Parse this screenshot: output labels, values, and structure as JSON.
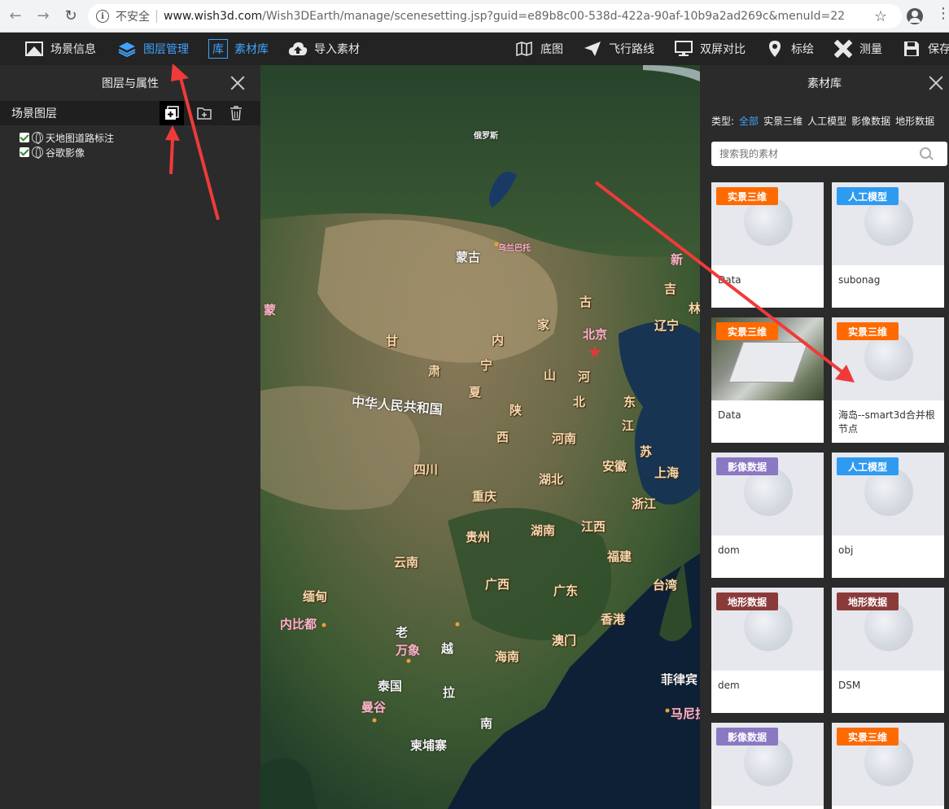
{
  "browser": {
    "insecure_label": "不安全",
    "url_host": "www.wish3d.com",
    "url_path": "/Wish3DEarth/manage/scenesetting.jsp?guid=e89b8c00-538d-422a-90af-10b9a2ad269c&menuId=22"
  },
  "toolbar": {
    "scene_info": "场景信息",
    "layer_manage": "图层管理",
    "library_icon": "库",
    "library": "素材库",
    "import": "导入素材",
    "basemap": "底图",
    "flight": "飞行路线",
    "dual": "双屏对比",
    "mark": "标绘",
    "measure": "测量",
    "save": "保存"
  },
  "left_panel": {
    "title": "图层与属性",
    "section": "场景图层",
    "layers": [
      "天地图道路标注",
      "谷歌影像"
    ]
  },
  "map": {
    "labels": [
      "俄罗斯",
      "蒙古",
      "乌兰巴托",
      "中华人民共和国",
      "北京",
      "内",
      "家",
      "古",
      "辽宁",
      "吉",
      "林",
      "宁",
      "夏",
      "甘",
      "肃",
      "陕",
      "西",
      "山",
      "河",
      "北",
      "东",
      "江",
      "苏",
      "安徽",
      "上海",
      "河南",
      "湖北",
      "浙江",
      "四川",
      "重庆",
      "贵州",
      "湖南",
      "江西",
      "福建",
      "台湾",
      "云南",
      "广西",
      "广东",
      "香港",
      "澳门",
      "海南",
      "缅甸",
      "内比都",
      "老",
      "万象",
      "越",
      "泰国",
      "曼谷",
      "南",
      "柬埔寨",
      "菲律宾",
      "马尼拉",
      "拉",
      "蒙",
      "新"
    ]
  },
  "right_panel": {
    "title": "素材库",
    "types_label": "类型:",
    "types": [
      "全部",
      "实景三维",
      "人工模型",
      "影像数据",
      "地形数据"
    ],
    "search_placeholder": "搜索我的素材",
    "cards": [
      {
        "badge": "实景三维",
        "name": "Data"
      },
      {
        "badge": "人工模型",
        "name": "subonag"
      },
      {
        "badge": "实景三维",
        "name": "Data"
      },
      {
        "badge": "实景三维",
        "name": "海岛--smart3d合并根节点"
      },
      {
        "badge": "影像数据",
        "name": "dom"
      },
      {
        "badge": "人工模型",
        "name": "obj"
      },
      {
        "badge": "地形数据",
        "name": "dem"
      },
      {
        "badge": "地形数据",
        "name": "DSM"
      },
      {
        "badge": "影像数据",
        "name": ""
      },
      {
        "badge": "实景三维",
        "name": ""
      }
    ]
  },
  "colors": {
    "accent": "#3fa3ff",
    "badge_realistic": "#ff6a00",
    "badge_model": "#2f9bf0",
    "badge_image": "#8a78c2",
    "badge_terrain": "#8b3a3a",
    "annotation_arrow": "#f03a3a"
  }
}
